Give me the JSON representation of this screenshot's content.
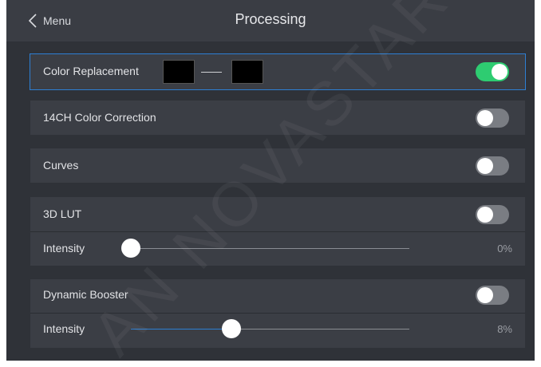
{
  "header": {
    "back_label": "Menu",
    "title": "Processing"
  },
  "rows": {
    "color_replacement": {
      "label": "Color Replacement",
      "enabled": true,
      "swatch_from": "#000000",
      "swatch_to": "#000000"
    },
    "color_correction": {
      "label": "14CH Color Correction",
      "enabled": false
    },
    "curves": {
      "label": "Curves",
      "enabled": false
    },
    "lut": {
      "label": "3D LUT",
      "enabled": false,
      "intensity_label": "Intensity",
      "intensity_value": "0%",
      "intensity_fraction": 0.0
    },
    "dynamic_booster": {
      "label": "Dynamic Booster",
      "enabled": false,
      "intensity_label": "Intensity",
      "intensity_value": "8%",
      "intensity_fraction": 0.36
    }
  },
  "watermark": "AN NOVASTAR",
  "colors": {
    "accent": "#2d7fd3",
    "toggle_on": "#2ecc71",
    "toggle_off": "#7a7d83",
    "background": "#2f3238"
  }
}
